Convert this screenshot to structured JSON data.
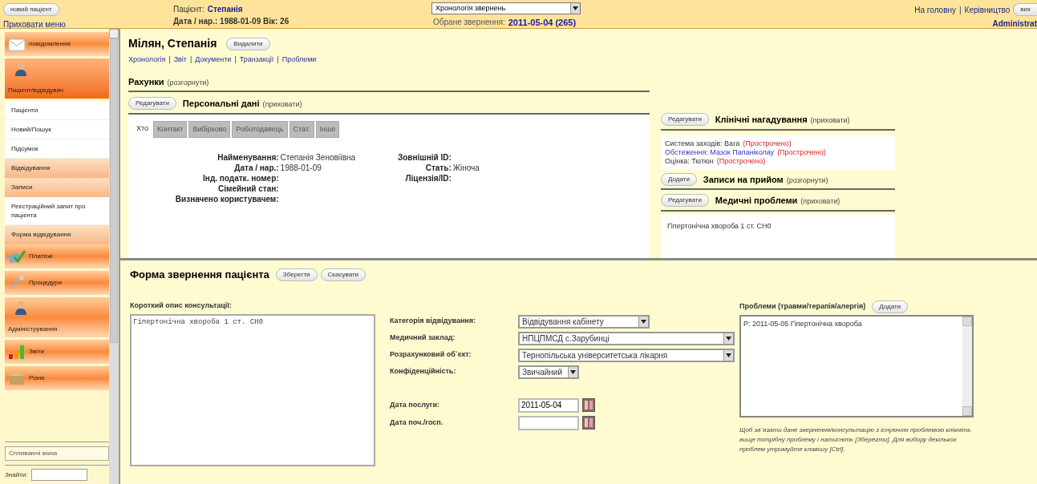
{
  "top_bar": {
    "new_patient_button": "новий пацієнт",
    "hide_menu_link": "Приховати меню",
    "patient_label": "Пацієнт:",
    "patient_name": "Степанія",
    "patient_dob": "Дата / нар.: 1988-01-09 Вік: 26",
    "history_select": "Хронологія звернень",
    "selected_encounter_label": "Обране звернення:",
    "selected_encounter": "2011-05-04 (265)",
    "home_link": "На головну",
    "separator": "|",
    "manual_link": "Керівництво",
    "logout_button": "вих",
    "user": "Administrat"
  },
  "sidebar": {
    "items": [
      {
        "kind": "header",
        "label": "повідомлення",
        "selected": false
      },
      {
        "kind": "header",
        "label": "Пацієнт/відвідувач",
        "selected": true
      },
      {
        "kind": "sub",
        "label": "Пацієнти",
        "selected": false
      },
      {
        "kind": "sub",
        "label": "Новий/Пошук",
        "selected": false
      },
      {
        "kind": "sub",
        "label": "Підсумок",
        "selected": false
      },
      {
        "kind": "section",
        "label": "Відвідування",
        "selected": false
      },
      {
        "kind": "section",
        "label": "Записи",
        "selected": false
      },
      {
        "kind": "sub",
        "label": "Реєстраційний запит про пацієнта",
        "selected": false
      },
      {
        "kind": "section",
        "label": "Форма відвідування",
        "selected": false
      },
      {
        "kind": "header",
        "label": "Платежі",
        "selected": false
      },
      {
        "kind": "header",
        "label": "Процедури",
        "selected": false
      },
      {
        "kind": "header",
        "label": "Адміністрування",
        "selected": false
      },
      {
        "kind": "header",
        "label": "Звіти",
        "selected": false
      },
      {
        "kind": "header",
        "label": "Різне",
        "selected": false
      }
    ],
    "popups_select": "Спливаючі вікна",
    "find_label": "Знайти:"
  },
  "summary": {
    "name": "Мілян, Степанія",
    "delete_button": "Видалити",
    "links": [
      "Хронологія",
      "Звіт",
      "Документи",
      "Транзакції",
      "Проблеми"
    ],
    "links_separator": "|",
    "billing": {
      "title": "Рахунки",
      "toggle": "(розгорнути)"
    },
    "demographics": {
      "edit_button": "Редагувати",
      "title": "Персональні дані",
      "toggle": "(приховати)",
      "tabs": [
        {
          "label": "Хто",
          "selected": true
        },
        {
          "label": "Контакт",
          "selected": false
        },
        {
          "label": "Вибірково",
          "selected": false
        },
        {
          "label": "Роботодавець",
          "selected": false
        },
        {
          "label": "Стат.",
          "selected": false
        },
        {
          "label": "Інше",
          "selected": false
        }
      ],
      "fields_left": [
        {
          "label": "Найменування:",
          "value": "Степанія Зеновіївна"
        },
        {
          "label": "Дата / нар.:",
          "value": "1988-01-09"
        },
        {
          "label": "Інд. податк. номер:"
        },
        {
          "label": "Сімейний стан:"
        },
        {
          "label": "Визначено користувачем:"
        }
      ],
      "fields_right": [
        {
          "label": "Зовнішній ID:"
        },
        {
          "label": "Стать:",
          "value": "Жіноча"
        },
        {
          "label": "Ліцензія/ID:"
        }
      ]
    },
    "reminders": {
      "edit_button": "Редагувати",
      "title": "Клінічні нагадування",
      "toggle": "(приховати)",
      "items": [
        {
          "kind": "text",
          "text": "Система заходів: Вага",
          "status": "(Прострочено)"
        },
        {
          "kind": "link",
          "text": "Обстеження: Мазок Папаніколау",
          "status": "(Прострочено)"
        },
        {
          "kind": "text",
          "text": "Оцінка: Тютюн",
          "status": "(Прострочено)"
        }
      ]
    },
    "appointments": {
      "add_button": "Додати",
      "title": "Записи на прийом",
      "toggle": "(розгорнути)"
    },
    "problems": {
      "edit_button": "Редагувати",
      "title": "Медичні проблеми",
      "toggle": "(приховати)",
      "items": [
        "Гіпертонічна хвороба 1 ст. СН0"
      ]
    }
  },
  "encounter_form": {
    "title": "Форма звернення пацієнта",
    "save_button": "Зберегти",
    "cancel_button": "Скасувати",
    "description_label": "Короткий опис консультації:",
    "description": "Гіпертонічна хвороба 1 ст. СН0",
    "selects": [
      {
        "label": "Категорія відвідування:",
        "value": "Відвідування кабінету"
      },
      {
        "label": "Медичний заклад:",
        "value": "НПЦПМСД с.Зарубинці"
      },
      {
        "label": "Розрахунковий об`єкт:",
        "value": "Тернопільська університетська лікарня"
      },
      {
        "label": "Конфіденційність:",
        "value": "Звичайний"
      }
    ],
    "dates": [
      {
        "label": "Дата послуги:",
        "value": "2011-05-04"
      },
      {
        "label": "Дата поч./госп."
      }
    ],
    "issues_label": "Проблеми (травми/терапія/алергія)",
    "issues_add_button": "Додати",
    "issues": [
      "P: 2011-05-05 Гіпертонічна хвороба"
    ],
    "note": "Щоб зв`язати дане звернення/консультацію з існуючою проблемою клікніть вище потрібну проблему і натисніть [Зберегти]. Для вибору декількох проблем утримуйте клавішу [Ctrl]."
  }
}
